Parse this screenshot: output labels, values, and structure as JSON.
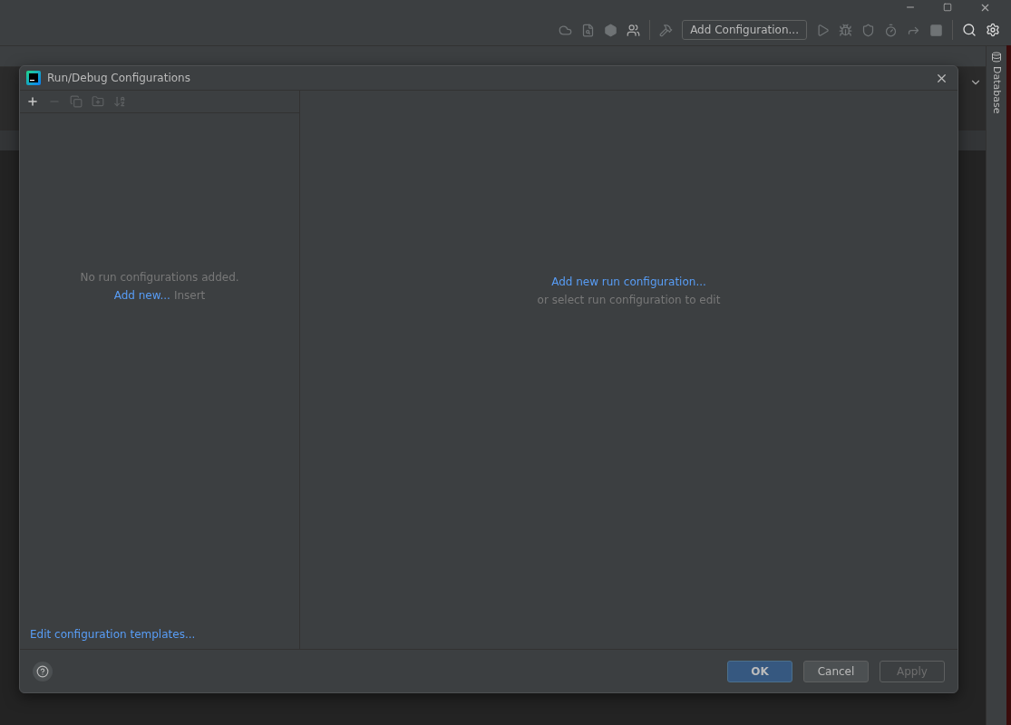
{
  "toolbar": {
    "run_config_button": "Add Configuration..."
  },
  "right_stripe": {
    "tabs": [
      {
        "label": "Database"
      }
    ]
  },
  "dialog": {
    "title": "Run/Debug Configurations",
    "tools": [
      {
        "kind": "add",
        "disabled": false
      },
      {
        "kind": "remove",
        "disabled": true
      },
      {
        "kind": "copy",
        "disabled": true
      },
      {
        "kind": "folder",
        "disabled": true
      },
      {
        "kind": "sort",
        "disabled": true
      }
    ],
    "empty_list": {
      "message": "No run configurations added.",
      "link": "Add new...",
      "shortcut": "Insert"
    },
    "templates_link": "Edit configuration templates...",
    "detail": {
      "link": "Add new run configuration...",
      "hint": "or select run configuration to edit"
    },
    "buttons": [
      {
        "label": "OK",
        "kind": "default",
        "disabled": false
      },
      {
        "label": "Cancel",
        "kind": "normal",
        "disabled": false
      },
      {
        "label": "Apply",
        "kind": "normal",
        "disabled": true
      }
    ]
  }
}
